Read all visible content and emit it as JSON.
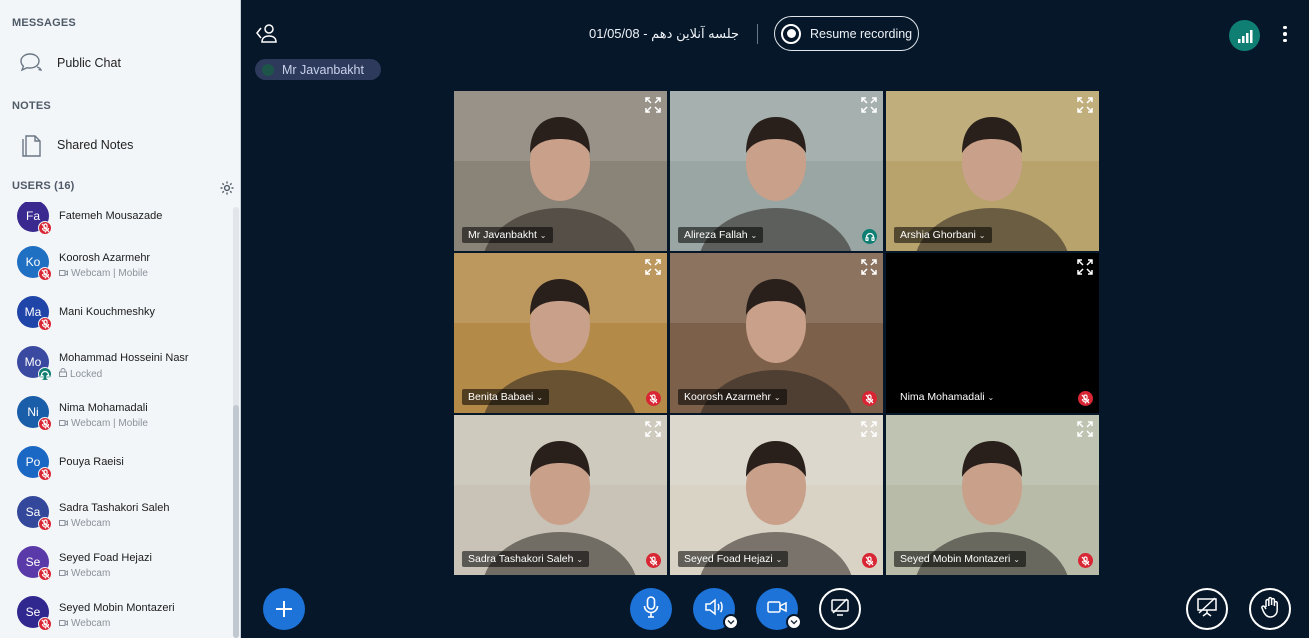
{
  "sidebar": {
    "messages_title": "MESSAGES",
    "public_chat": {
      "label": "Public Chat",
      "icon": "chat-bubbles-icon"
    },
    "notes_title": "NOTES",
    "shared_notes": {
      "label": "Shared Notes",
      "icon": "document-icon"
    },
    "users_title": "USERS (16)",
    "users": [
      {
        "initials": "Fa",
        "name": "Fatemeh Mousazade",
        "sub": "",
        "sub_icon": "",
        "avatar_color": "#3a2a8f",
        "status": "muted"
      },
      {
        "initials": "Ko",
        "name": "Koorosh Azarmehr",
        "sub": "Webcam | Mobile",
        "sub_icon": "webcam-icon",
        "avatar_color": "#1f6fc2",
        "status": "muted"
      },
      {
        "initials": "Ma",
        "name": "Mani Kouchmeshky",
        "sub": "",
        "sub_icon": "",
        "avatar_color": "#2045a8",
        "status": "muted"
      },
      {
        "initials": "Mo",
        "name": "Mohammad Hosseini Nasr",
        "sub": "Locked",
        "sub_icon": "lock-icon",
        "avatar_color": "#3a4aa0",
        "status": "listen-only"
      },
      {
        "initials": "Ni",
        "name": "Nima Mohamadali",
        "sub": "Webcam | Mobile",
        "sub_icon": "webcam-icon",
        "avatar_color": "#1a5da8",
        "status": "muted"
      },
      {
        "initials": "Po",
        "name": "Pouya Raeisi",
        "sub": "",
        "sub_icon": "",
        "avatar_color": "#1b68c4",
        "status": "muted"
      },
      {
        "initials": "Sa",
        "name": "Sadra Tashakori Saleh",
        "sub": "Webcam",
        "sub_icon": "webcam-icon",
        "avatar_color": "#34489b",
        "status": "muted"
      },
      {
        "initials": "Se",
        "name": "Seyed Foad Hejazi",
        "sub": "Webcam",
        "sub_icon": "webcam-icon",
        "avatar_color": "#5a3aa8",
        "status": "muted"
      },
      {
        "initials": "Se",
        "name": "Seyed Mobin Montazeri",
        "sub": "Webcam",
        "sub_icon": "webcam-icon",
        "avatar_color": "#30278f",
        "status": "muted"
      }
    ]
  },
  "header": {
    "meeting_title": "01/05/08 - جلسه آنلاین دهم",
    "recording_label": "Resume recording",
    "presenter_name": "Mr Javanbakht"
  },
  "videos": [
    {
      "name": "Mr Javanbakht",
      "status": "none",
      "bg": "#8a8378"
    },
    {
      "name": "Alireza Fallah",
      "status": "listen-only",
      "bg": "#9aa6a3"
    },
    {
      "name": "Arshia Ghorbani",
      "status": "none",
      "bg": "#b8a36c"
    },
    {
      "name": "Benita Babaei",
      "status": "muted",
      "bg": "#b48a48"
    },
    {
      "name": "Koorosh Azarmehr",
      "status": "muted",
      "bg": "#7d6049"
    },
    {
      "name": "Nima Mohamadali",
      "status": "muted",
      "bg": "#000000"
    },
    {
      "name": "Sadra Tashakori Saleh",
      "status": "muted",
      "bg": "#c8c3b6"
    },
    {
      "name": "Seyed Foad Hejazi",
      "status": "muted",
      "bg": "#d9d3c6"
    },
    {
      "name": "Seyed Mobin Montazeri",
      "status": "muted",
      "bg": "#b7bba8"
    }
  ],
  "colors": {
    "background": "#06172a",
    "accent_blue": "#1d73d8",
    "muted_red": "#d82634",
    "teal": "#0f7f74"
  }
}
